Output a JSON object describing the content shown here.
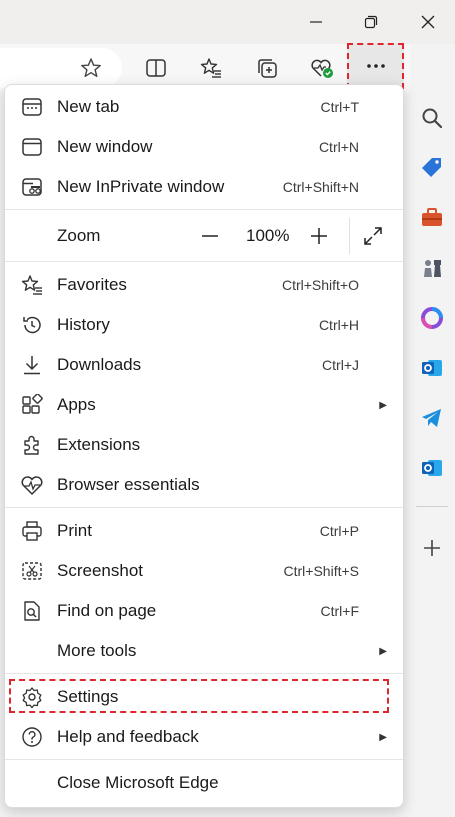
{
  "window": {
    "minimize_icon": "minimize-icon",
    "restore_icon": "restore-icon",
    "close_icon": "close-icon"
  },
  "toolbar": {
    "icons": [
      "favorite-star-icon",
      "split-screen-icon",
      "favorites-icon",
      "collections-icon",
      "browser-essentials-icon",
      "more-icon",
      "copilot-icon"
    ]
  },
  "menu": {
    "new_tab": {
      "label": "New tab",
      "shortcut": "Ctrl+T"
    },
    "new_window": {
      "label": "New window",
      "shortcut": "Ctrl+N"
    },
    "new_inprivate": {
      "label": "New InPrivate window",
      "shortcut": "Ctrl+Shift+N"
    },
    "zoom": {
      "label": "Zoom",
      "minus": "—",
      "value": "100%",
      "plus": "+"
    },
    "favorites": {
      "label": "Favorites",
      "shortcut": "Ctrl+Shift+O"
    },
    "history": {
      "label": "History",
      "shortcut": "Ctrl+H"
    },
    "downloads": {
      "label": "Downloads",
      "shortcut": "Ctrl+J"
    },
    "apps": {
      "label": "Apps"
    },
    "extensions": {
      "label": "Extensions"
    },
    "browser_essentials": {
      "label": "Browser essentials"
    },
    "print": {
      "label": "Print",
      "shortcut": "Ctrl+P"
    },
    "screenshot": {
      "label": "Screenshot",
      "shortcut": "Ctrl+Shift+S"
    },
    "find": {
      "label": "Find on page",
      "shortcut": "Ctrl+F"
    },
    "more_tools": {
      "label": "More tools"
    },
    "settings": {
      "label": "Settings"
    },
    "help": {
      "label": "Help and feedback"
    },
    "close_edge": {
      "label": "Close Microsoft Edge"
    }
  },
  "sidebar": {
    "icons": [
      "search-icon",
      "shopping-tag-icon",
      "tools-icon",
      "games-icon",
      "microsoft365-icon",
      "outlook-icon",
      "telegram-icon",
      "outlook-icon",
      "add-icon"
    ]
  },
  "colors": {
    "highlight": "#e0262d",
    "accent": "#0067c0"
  }
}
